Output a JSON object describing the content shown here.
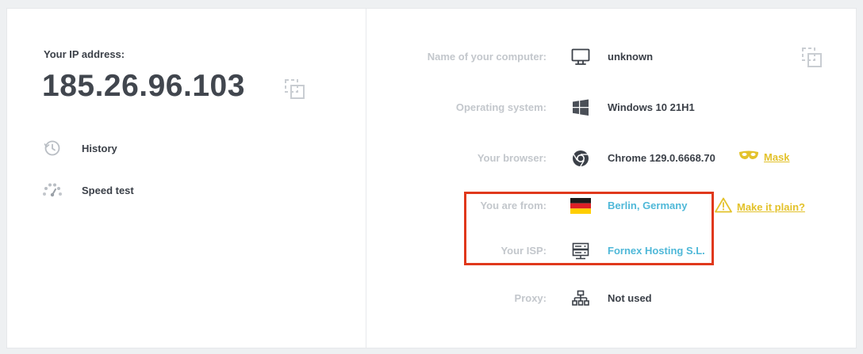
{
  "ip_section": {
    "label": "Your IP address:",
    "ip": "185.26.96.103"
  },
  "left_links": [
    {
      "label": "History",
      "icon": "history-icon"
    },
    {
      "label": "Speed test",
      "icon": "speedometer-icon"
    }
  ],
  "details": {
    "computer": {
      "label": "Name of your computer:",
      "value": "unknown",
      "icon": "monitor-icon"
    },
    "os": {
      "label": "Operating system:",
      "value": "Windows 10 21H1",
      "icon": "windows-icon"
    },
    "browser": {
      "label": "Your browser:",
      "value": "Chrome 129.0.6668.70",
      "icon": "chrome-icon",
      "action_label": "Mask",
      "action_icon": "mask-icon"
    },
    "location": {
      "label": "You are from:",
      "value": "Berlin, Germany",
      "icon": "germany-flag-icon",
      "action_label": "Make it plain?",
      "action_icon": "warning-icon"
    },
    "isp": {
      "label": "Your ISP:",
      "value": "Fornex Hosting S.L.",
      "icon": "server-icon"
    },
    "proxy": {
      "label": "Proxy:",
      "value": "Not used",
      "icon": "network-icon"
    }
  },
  "colors": {
    "accent_link": "#4fb8d8",
    "accent_yellow": "#e3c22b",
    "highlight_border": "#e0381c",
    "text_dark": "#3b4048",
    "label_gray": "#c3c7cc"
  }
}
